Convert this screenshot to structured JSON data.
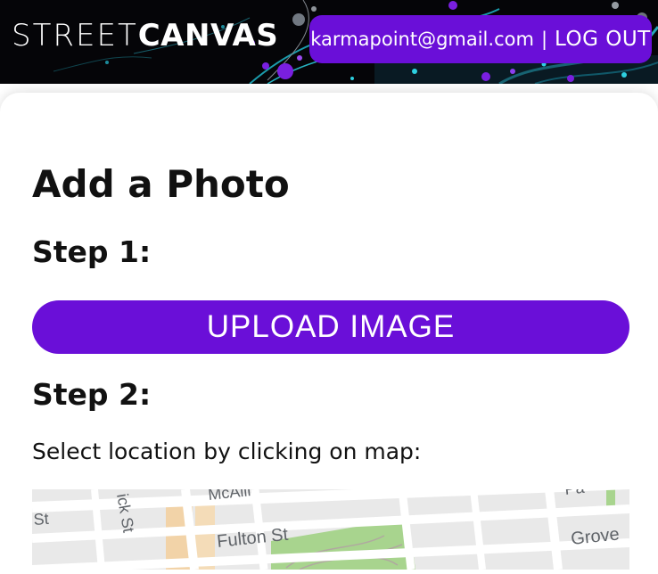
{
  "header": {
    "logo_light": "STREET",
    "logo_bold": "CANVAS",
    "email": "karmapoint@gmail.com",
    "separator": "|",
    "logout_label": "LOG OUT"
  },
  "main": {
    "title": "Add a Photo",
    "step1_label": "Step 1:",
    "upload_label": "UPLOAD IMAGE",
    "step2_label": "Step 2:",
    "instructions": "Select location by clicking on map:"
  },
  "map": {
    "street_labels": [
      "St",
      "ick St",
      "McAlli",
      "Fulton St",
      "Grove",
      "Pa"
    ]
  },
  "colors": {
    "accent": "#6a0fd8",
    "header_bg": "#050508",
    "map_park": "#a8d48e",
    "map_road": "#ffffff",
    "map_block": "#e9e9e9",
    "map_building": "#f2d3a8"
  }
}
